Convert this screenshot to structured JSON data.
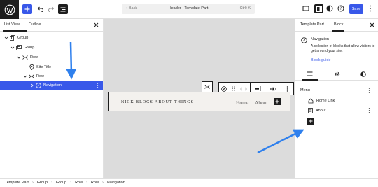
{
  "topbar": {
    "back_label": "Back",
    "document_title": "Header · Template Part",
    "shortcut": "Ctrl+K",
    "save_label": "Save"
  },
  "left_panel": {
    "tabs": [
      "List View",
      "Outline"
    ],
    "tree": [
      {
        "label": "Group",
        "icon": "group-icon"
      },
      {
        "label": "Group",
        "icon": "group-icon"
      },
      {
        "label": "Row",
        "icon": "row-icon"
      },
      {
        "label": "Site Title",
        "icon": "location-pin-icon"
      },
      {
        "label": "Row",
        "icon": "row-icon"
      },
      {
        "label": "Navigation",
        "icon": "compass-icon",
        "selected": true
      }
    ]
  },
  "canvas": {
    "site_title": "NICK BLOGS ABOUT THINGS",
    "nav_links": [
      "Home",
      "About"
    ]
  },
  "right_panel": {
    "tabs": [
      "Template Part",
      "Block"
    ],
    "block_name": "Navigation",
    "block_description": "A collection of blocks that allow visitors to get around your site.",
    "block_guide": "Block guide",
    "menu_label": "Menu",
    "menu_items": [
      {
        "label": "Home Link",
        "icon": "home-icon"
      },
      {
        "label": "About",
        "icon": "page-icon"
      }
    ]
  },
  "breadcrumb": [
    "Template Part",
    "Group",
    "Group",
    "Row",
    "Row",
    "Navigation"
  ],
  "colors": {
    "accent": "#3858e9",
    "dark": "#1e1e1e",
    "canvas": "#dcdcdc",
    "arrow": "#2f80ed"
  }
}
